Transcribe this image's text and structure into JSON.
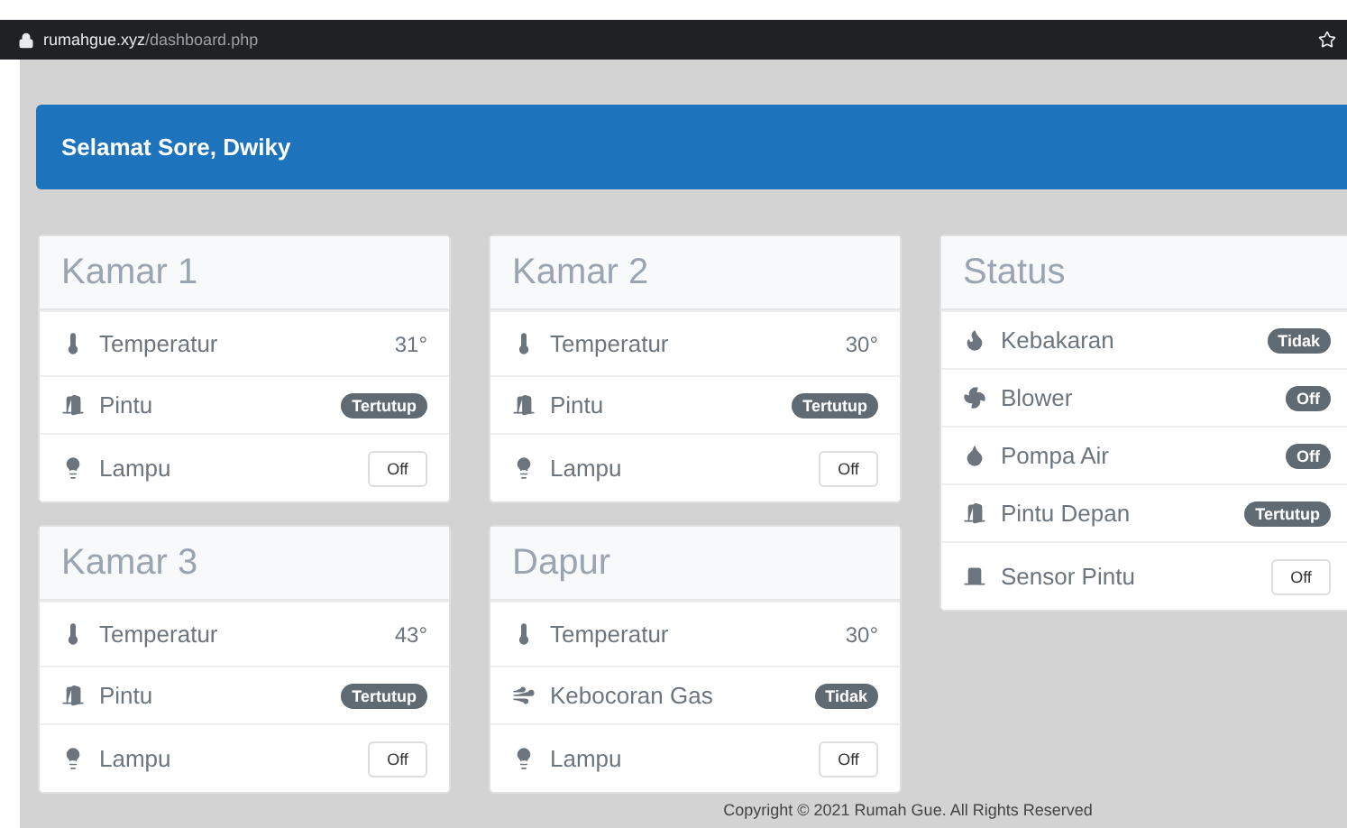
{
  "address_bar": {
    "domain": "rumahgue.xyz",
    "path": "/dashboard.php"
  },
  "greeting": "Selamat Sore, Dwiky",
  "cards": [
    {
      "title": "Kamar 1",
      "rows": [
        {
          "kind": "reading",
          "label": "Temperatur",
          "value": "31°"
        },
        {
          "kind": "badge",
          "label": "Pintu",
          "value": "Tertutup"
        },
        {
          "kind": "toggle",
          "label": "Lampu",
          "value": "Off"
        }
      ]
    },
    {
      "title": "Kamar 2",
      "rows": [
        {
          "kind": "reading",
          "label": "Temperatur",
          "value": "30°"
        },
        {
          "kind": "badge",
          "label": "Pintu",
          "value": "Tertutup"
        },
        {
          "kind": "toggle",
          "label": "Lampu",
          "value": "Off"
        }
      ]
    },
    {
      "title": "Status",
      "rows": [
        {
          "kind": "badge",
          "label": "Kebakaran",
          "value": "Tidak"
        },
        {
          "kind": "badge",
          "label": "Blower",
          "value": "Off"
        },
        {
          "kind": "badge",
          "label": "Pompa Air",
          "value": "Off"
        },
        {
          "kind": "badge",
          "label": "Pintu Depan",
          "value": "Tertutup"
        },
        {
          "kind": "toggle",
          "label": "Sensor Pintu",
          "value": "Off"
        }
      ]
    },
    {
      "title": "Kamar 3",
      "rows": [
        {
          "kind": "reading",
          "label": "Temperatur",
          "value": "43°"
        },
        {
          "kind": "badge",
          "label": "Pintu",
          "value": "Tertutup"
        },
        {
          "kind": "toggle",
          "label": "Lampu",
          "value": "Off"
        }
      ]
    },
    {
      "title": "Dapur",
      "rows": [
        {
          "kind": "reading",
          "label": "Temperatur",
          "value": "30°"
        },
        {
          "kind": "badge",
          "label": "Kebocoran Gas",
          "value": "Tidak"
        },
        {
          "kind": "toggle",
          "label": "Lampu",
          "value": "Off"
        }
      ]
    }
  ],
  "footer": "Copyright © 2021 Rumah Gue. All Rights Reserved"
}
